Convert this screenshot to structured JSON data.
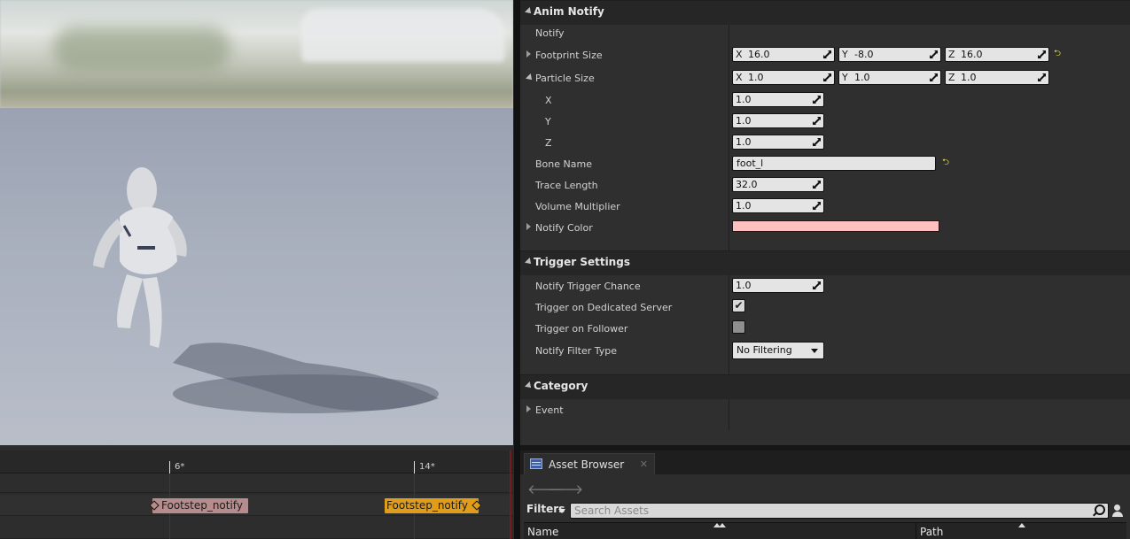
{
  "details": {
    "categories": {
      "anim_notify": "Anim Notify",
      "trigger_settings": "Trigger Settings",
      "category": "Category"
    },
    "rows": {
      "notify": "Notify",
      "footprint_size": "Footprint Size",
      "particle_size": "Particle Size",
      "px": "X",
      "py": "Y",
      "pz": "Z",
      "bone_name": "Bone Name",
      "trace_length": "Trace Length",
      "volume_multiplier": "Volume Multiplier",
      "notify_color": "Notify Color",
      "notify_trigger_chance": "Notify Trigger Chance",
      "trigger_dedicated": "Trigger on Dedicated Server",
      "trigger_follower": "Trigger on Follower",
      "notify_filter_type": "Notify Filter Type",
      "event": "Event"
    },
    "axes": {
      "x": "X",
      "y": "Y",
      "z": "Z"
    },
    "values": {
      "footprint_x": "16.0",
      "footprint_y": "-8.0",
      "footprint_z": "16.0",
      "particle_x": "1.0",
      "particle_y": "1.0",
      "particle_z": "1.0",
      "sub_x": "1.0",
      "sub_y": "1.0",
      "sub_z": "1.0",
      "bone_name": "foot_l",
      "trace_length": "32.0",
      "volume_multiplier": "1.0",
      "notify_trigger_chance": "1.0",
      "notify_filter_type": "No Filtering"
    },
    "checks": {
      "dedicated": "✔",
      "follower": ""
    },
    "notify_color": "#ffc0c0",
    "reset_glyph": "⮌"
  },
  "timeline": {
    "ticks": [
      "6*",
      "14*"
    ],
    "notifies": [
      "Footstep_notify",
      "Footstep_notify"
    ]
  },
  "asset_browser": {
    "tab_label": "Asset Browser",
    "close_glyph": "✕",
    "back_glyph": "🡐",
    "forward_glyph": "🡒",
    "filters_label": "Filters",
    "search_placeholder": "Search Assets",
    "col_name": "Name",
    "col_path": "Path"
  },
  "colors": {
    "notify_pink": "#b78c8c",
    "notify_orange": "#e09d1b",
    "panel_bg": "#2f2f2f"
  }
}
